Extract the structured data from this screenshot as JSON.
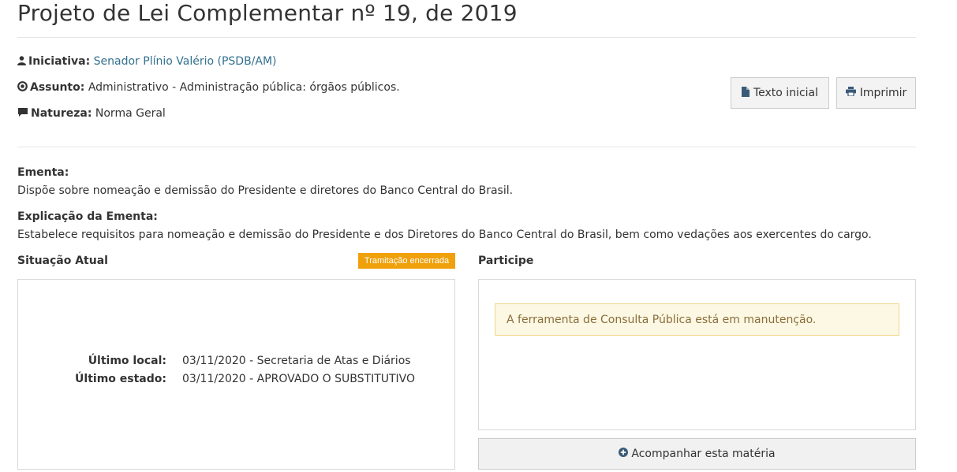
{
  "page": {
    "title": "Projeto de Lei Complementar nº 19, de 2019"
  },
  "meta": {
    "iniciativa_label": "Iniciativa",
    "iniciativa_value": "Senador Plínio Valério (PSDB/AM)",
    "assunto_label": "Assunto",
    "assunto_value": "Administrativo - Administração pública: órgãos públicos.",
    "natureza_label": "Natureza",
    "natureza_value": "Norma Geral"
  },
  "actions": {
    "texto_inicial": "Texto inicial",
    "imprimir": "Imprimir"
  },
  "ementa": {
    "label": "Ementa",
    "text": "Dispõe sobre nomeação e demissão do Presidente e diretores do Banco Central do Brasil."
  },
  "explicacao": {
    "label": "Explicação da Ementa",
    "text": "Estabelece requisitos para nomeação e demissão do Presidente e dos Diretores do Banco Central do Brasil, bem como vedações aos exercentes do cargo."
  },
  "situacao": {
    "heading": "Situação Atual",
    "badge": "Tramitação encerrada",
    "ultimo_local_label": "Último local:",
    "ultimo_local_value": "03/11/2020 - Secretaria de Atas e Diários",
    "ultimo_estado_label": "Último estado:",
    "ultimo_estado_value": "03/11/2020 - APROVADO O SUBSTITUTIVO"
  },
  "participe": {
    "heading": "Participe",
    "alert": "A ferramenta de Consulta Pública está em manutenção.",
    "follow_button": "Acompanhar esta matéria"
  },
  "colors": {
    "link": "#31708f",
    "badge": "#f0a00b",
    "alert_bg": "#fcf8e3",
    "alert_text": "#8a6d3b"
  },
  "icons": {
    "iniciativa": "user-icon",
    "assunto": "dot-circle-icon",
    "natureza": "comment-icon",
    "texto_inicial": "file-icon",
    "imprimir": "print-icon",
    "follow": "plus-circle-icon"
  }
}
